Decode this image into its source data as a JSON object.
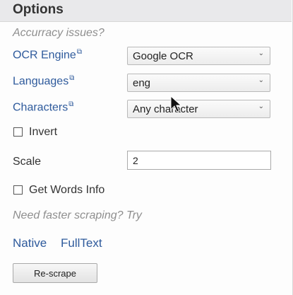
{
  "header": {
    "title": "Options"
  },
  "accuracy_hint": "Accurracy issues?",
  "fields": {
    "ocr_engine": {
      "label": "OCR Engine",
      "value": "Google OCR"
    },
    "languages": {
      "label": "Languages",
      "value": "eng"
    },
    "characters": {
      "label": "Characters",
      "value": "Any character"
    }
  },
  "invert": {
    "label": "Invert",
    "checked": false
  },
  "scale": {
    "label": "Scale",
    "value": "2"
  },
  "get_words_info": {
    "label": "Get Words Info",
    "checked": false
  },
  "faster_hint": "Need faster scraping? Try",
  "links": {
    "native": "Native",
    "fulltext": "FullText"
  },
  "buttons": {
    "rescrape": "Re-scrape"
  },
  "icons": {
    "external_link": "external-link-icon",
    "dropdown": "chevron-down-icon",
    "pointer": "mouse-pointer-icon"
  },
  "colors": {
    "link": "#2e5a9c",
    "hint": "#8f8f8f",
    "header_bg": "#e9e9eb"
  }
}
